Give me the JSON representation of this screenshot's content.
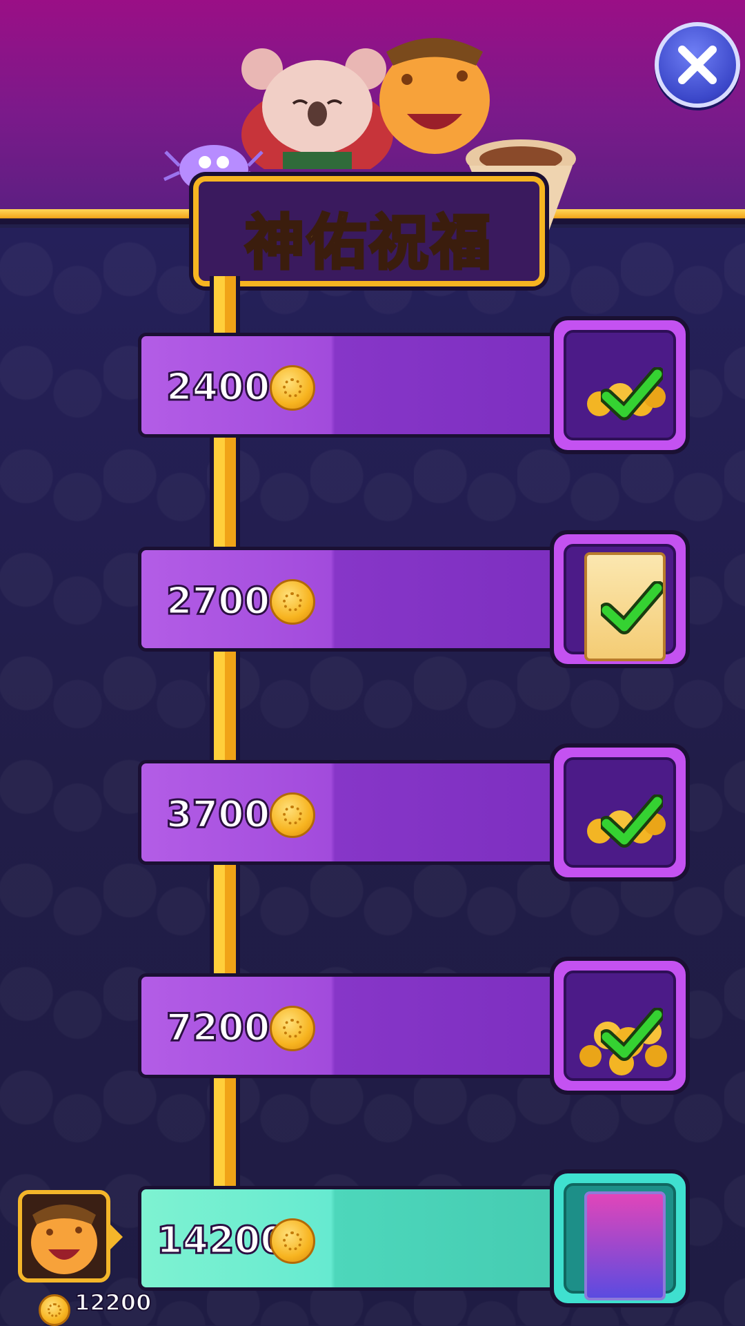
{
  "title": "神佑祝福",
  "tiers": [
    {
      "value": "2400",
      "reward": "coins",
      "claimed": true
    },
    {
      "value": "2700",
      "reward": "card",
      "claimed": true
    },
    {
      "value": "3700",
      "reward": "coins",
      "claimed": true
    },
    {
      "value": "7200",
      "reward": "coins-large",
      "claimed": true
    },
    {
      "value": "14200",
      "reward": "rare-card",
      "claimed": false
    }
  ],
  "player": {
    "balance": "12200"
  },
  "colors": {
    "header": "#9a0f86",
    "bar": "#a24bdc",
    "current_bar": "#66ead0",
    "accent": "#f6b521"
  },
  "icons": {
    "close": "close-icon",
    "coin": "coin-icon",
    "check": "check-icon"
  }
}
